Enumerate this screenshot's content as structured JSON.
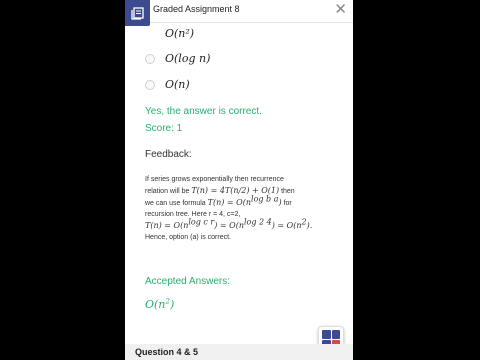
{
  "header": {
    "title": "Graded Assignment 8"
  },
  "options": [
    {
      "label": "O(n²)"
    },
    {
      "label": "O(log n)"
    },
    {
      "label": "O(n)"
    }
  ],
  "result": {
    "message": "Yes, the answer is correct.",
    "score": "Score: 1"
  },
  "feedback": {
    "heading": "Feedback:",
    "line1": "If series grows exponentially then recurrence",
    "line2a": "relation will be ",
    "line2m": "T(n) = 4T(n/2) + O(1)",
    "line2b": " then",
    "line3a": "we can use formula ",
    "line3m": "T(n) = O(n",
    "line3s": "log b a",
    "line3e": ")",
    "line3b": " for",
    "line4": "recursion tree. Here r = 4, c=2,",
    "line5m1": "T(n) = O(n",
    "line5s1": "log c r",
    "line5m2": ") = O(n",
    "line5s2": "log 2 4",
    "line5m3": ") = O(n",
    "line5s3": "2",
    "line5m4": ").",
    "line6": "Hence, option (a) is correct."
  },
  "accepted": {
    "heading": "Accepted Answers:",
    "base": "O(n",
    "sup": "2",
    "close": ")"
  },
  "footer": {
    "title": "Question 4 & 5"
  },
  "colors": {
    "accent": "#3d4a8f",
    "correct": "#27b06f"
  }
}
